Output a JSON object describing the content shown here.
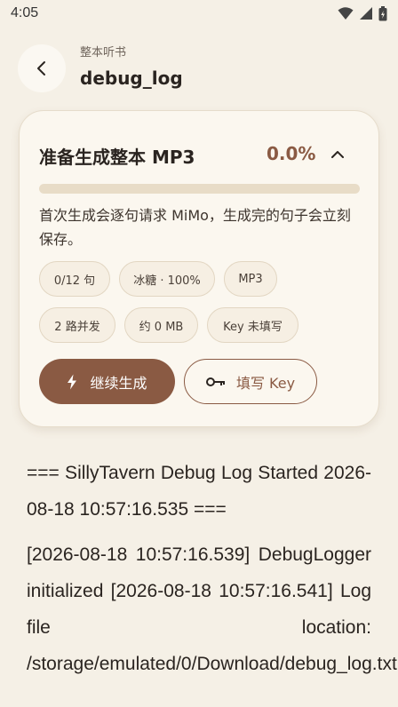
{
  "status_bar": {
    "time": "4:05"
  },
  "header": {
    "subtitle": "整本听书",
    "title": "debug_log"
  },
  "card": {
    "title": "准备生成整本 MP3",
    "percent_text": "0.0%",
    "progress_fraction": 0.0,
    "description": "首次生成会逐句请求 MiMo，生成完的句子会立刻保存。",
    "chips": [
      "0/12 句",
      "冰糖 · 100%",
      "MP3",
      "2 路并发",
      "约 0 MB",
      "Key 未填写"
    ],
    "primary_button": "继续生成",
    "secondary_button": "填写 Key"
  },
  "log": {
    "paragraphs": [
      "=== SillyTavern Debug Log Started 2026-08-18 10:57:16.535 ===",
      "[2026-08-18 10:57:16.539] DebugLogger initialized [2026-08-18 10:57:16.541] Log file location: /storage/emulated/0/Download/debug_log.txt"
    ]
  },
  "colors": {
    "accent": "#8a5a43",
    "background": "#f5f0e6",
    "card": "#fbf7ef"
  }
}
